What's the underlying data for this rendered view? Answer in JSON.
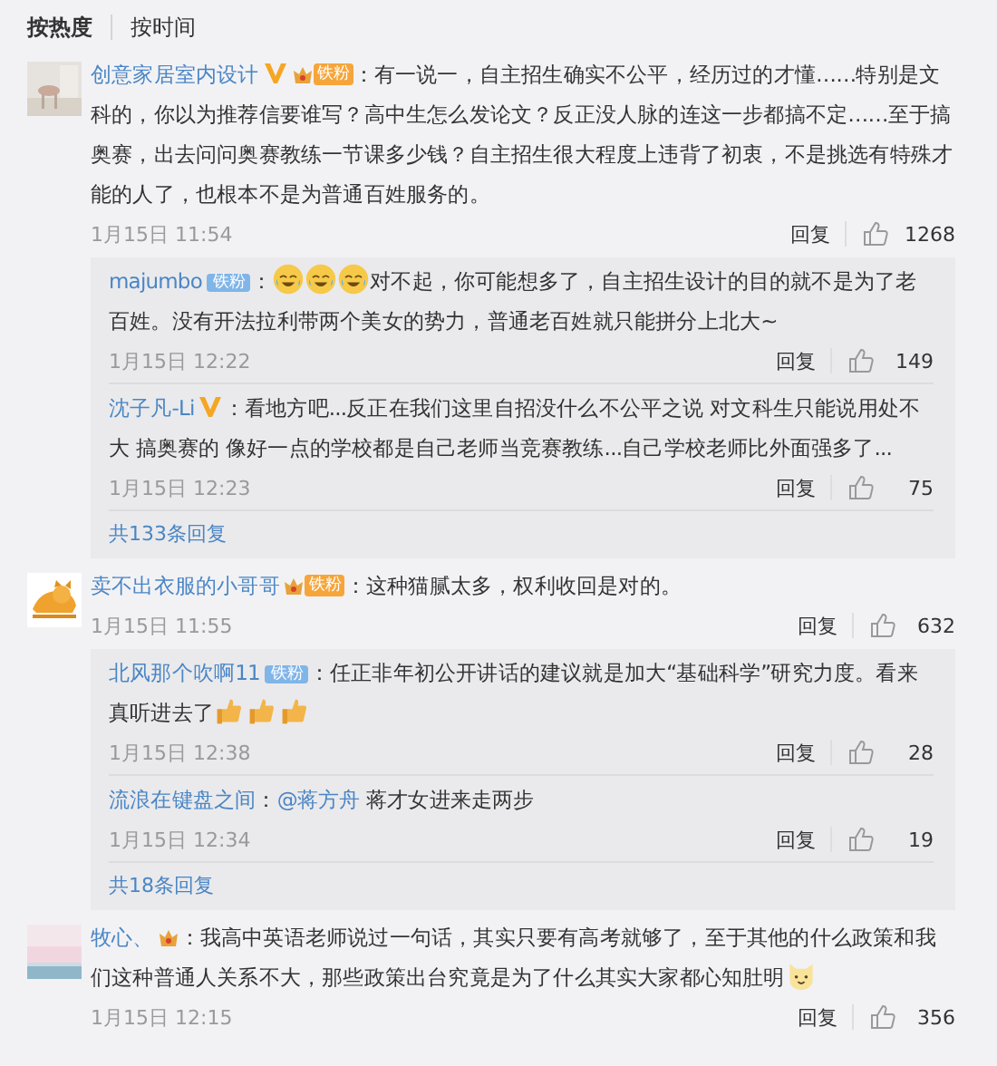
{
  "sort_tabs": [
    {
      "label": "按热度",
      "selected": true
    },
    {
      "label": "按时间",
      "selected": false
    }
  ],
  "comments": [
    {
      "name": "创意家居室内设计",
      "colon": "：",
      "verified": true,
      "badge": {
        "kind": "crown",
        "label": "铁粉"
      },
      "content": [
        {
          "kind": "text",
          "text": "有一说一，自主招生确实不公平，经历过的才懂……特别是文科的，你以为推荐信要谁写？高中生怎么发论文？反正没人脉的连这一步都搞不定……至于搞奥赛，出去问问奥赛教练一节课多少钱？自主招生很大程度上违背了初衷，不是挑选有特殊才能的人了，也根本不是为普通百姓服务的。"
        }
      ],
      "time": "1月15日 11:54",
      "reply": "回复",
      "likes": "1268",
      "replies": [
        {
          "name": "majumbo",
          "colon": "：",
          "verified": false,
          "badge": {
            "kind": "plain",
            "label": "铁粉"
          },
          "content": [
            {
              "kind": "laugh-emoji"
            },
            {
              "kind": "laugh-emoji"
            },
            {
              "kind": "laugh-emoji"
            },
            {
              "kind": "text",
              "text": "对不起，你可能想多了，自主招生设计的目的就不是为了老百姓。没有开法拉利带两个美女的势力，普通老百姓就只能拼分上北大~"
            }
          ],
          "time": "1月15日 12:22",
          "reply": "回复",
          "likes": "149"
        },
        {
          "name": "沈子凡-Li",
          "colon": "：",
          "verified": true,
          "content": [
            {
              "kind": "text",
              "text": "看地方吧...反正在我们这里自招没什么不公平之说 对文科生只能说用处不大 搞奥赛的 像好一点的学校都是自己老师当竞赛教练...自己学校老师比外面强多了..."
            }
          ],
          "time": "1月15日 12:23",
          "reply": "回复",
          "likes": "75"
        }
      ],
      "more_replies": "共133条回复"
    },
    {
      "name": "卖不出衣服的小哥哥",
      "colon": "：",
      "verified": false,
      "badge": {
        "kind": "crown",
        "label": "铁粉"
      },
      "content": [
        {
          "kind": "text",
          "text": "这种猫腻太多，权利收回是对的。"
        }
      ],
      "time": "1月15日 11:55",
      "reply": "回复",
      "likes": "632",
      "replies": [
        {
          "name": "北风那个吹啊11",
          "colon": "：",
          "verified": false,
          "badge": {
            "kind": "plain",
            "label": "铁粉"
          },
          "content": [
            {
              "kind": "text",
              "text": "任正非年初公开讲话的建议就是加大“基础科学”研究力度。看来真听进去了"
            },
            {
              "kind": "thumb-emoji"
            },
            {
              "kind": "thumb-emoji"
            },
            {
              "kind": "thumb-emoji"
            }
          ],
          "time": "1月15日 12:38",
          "reply": "回复",
          "likes": "28"
        },
        {
          "name": "流浪在键盘之间",
          "colon": "：",
          "verified": false,
          "content": [
            {
              "kind": "mention",
              "text": "@蒋方舟"
            },
            {
              "kind": "text",
              "text": " 蒋才女进来走两步"
            }
          ],
          "time": "1月15日 12:34",
          "reply": "回复",
          "likes": "19"
        }
      ],
      "more_replies": "共18条回复"
    },
    {
      "name": "牧心、",
      "colon": "：",
      "verified": false,
      "badge": {
        "kind": "crown"
      },
      "content": [
        {
          "kind": "text",
          "text": "我高中英语老师说过一句话，其实只要有高考就够了，至于其他的什么政策和我们这种普通人关系不大，那些政策出台究竟是为了什么其实大家都心知肚明"
        },
        {
          "kind": "cat-emoji"
        }
      ],
      "time": "1月15日 12:15",
      "reply": "回复",
      "likes": "356"
    }
  ]
}
